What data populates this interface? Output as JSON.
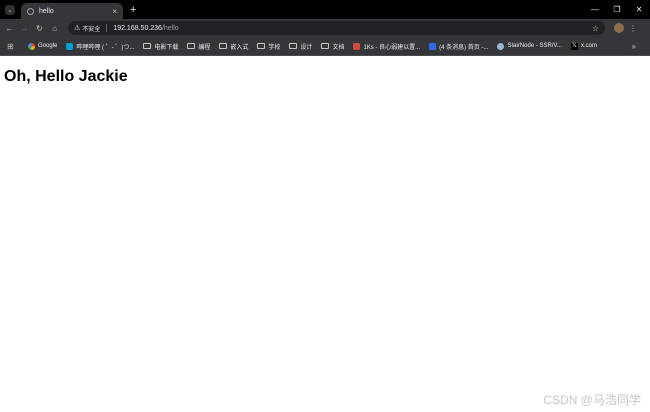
{
  "browser": {
    "tab": {
      "title": "hello",
      "close": "×"
    },
    "new_tab": "+",
    "window_controls": {
      "minimize": "—",
      "restore": "❐",
      "close": "✕"
    },
    "tab_search": "⌄",
    "nav": {
      "back": "←",
      "forward": "→",
      "reload": "↻",
      "home": "⌂"
    },
    "omnibox": {
      "warning_icon": "⚠",
      "security_label": "不安全",
      "url_host": "192.168.50.236",
      "url_path": "/hello",
      "star": "☆"
    },
    "menu": "⋮",
    "bookmarks": [
      {
        "label": "Google",
        "icon": "google"
      },
      {
        "label": "哔哩哔哩 ( ゜- ゜)つ...",
        "icon": "blue"
      },
      {
        "label": "电影下载",
        "icon": "folder"
      },
      {
        "label": "编程",
        "icon": "folder"
      },
      {
        "label": "嵌入式",
        "icon": "folder"
      },
      {
        "label": "学校",
        "icon": "folder"
      },
      {
        "label": "设计",
        "icon": "folder"
      },
      {
        "label": "文档",
        "icon": "folder"
      },
      {
        "label": "1Ks - 良心弱建以置...",
        "icon": "red"
      },
      {
        "label": "(4 条消息) 首页 -...",
        "icon": "navy"
      },
      {
        "label": "StairNode - SSR/V...",
        "icon": "wp"
      },
      {
        "label": "x.com",
        "icon": "x"
      }
    ],
    "bookmarks_more": "»"
  },
  "page": {
    "heading": "Oh, Hello Jackie"
  },
  "watermark": "CSDN @马浩同学"
}
